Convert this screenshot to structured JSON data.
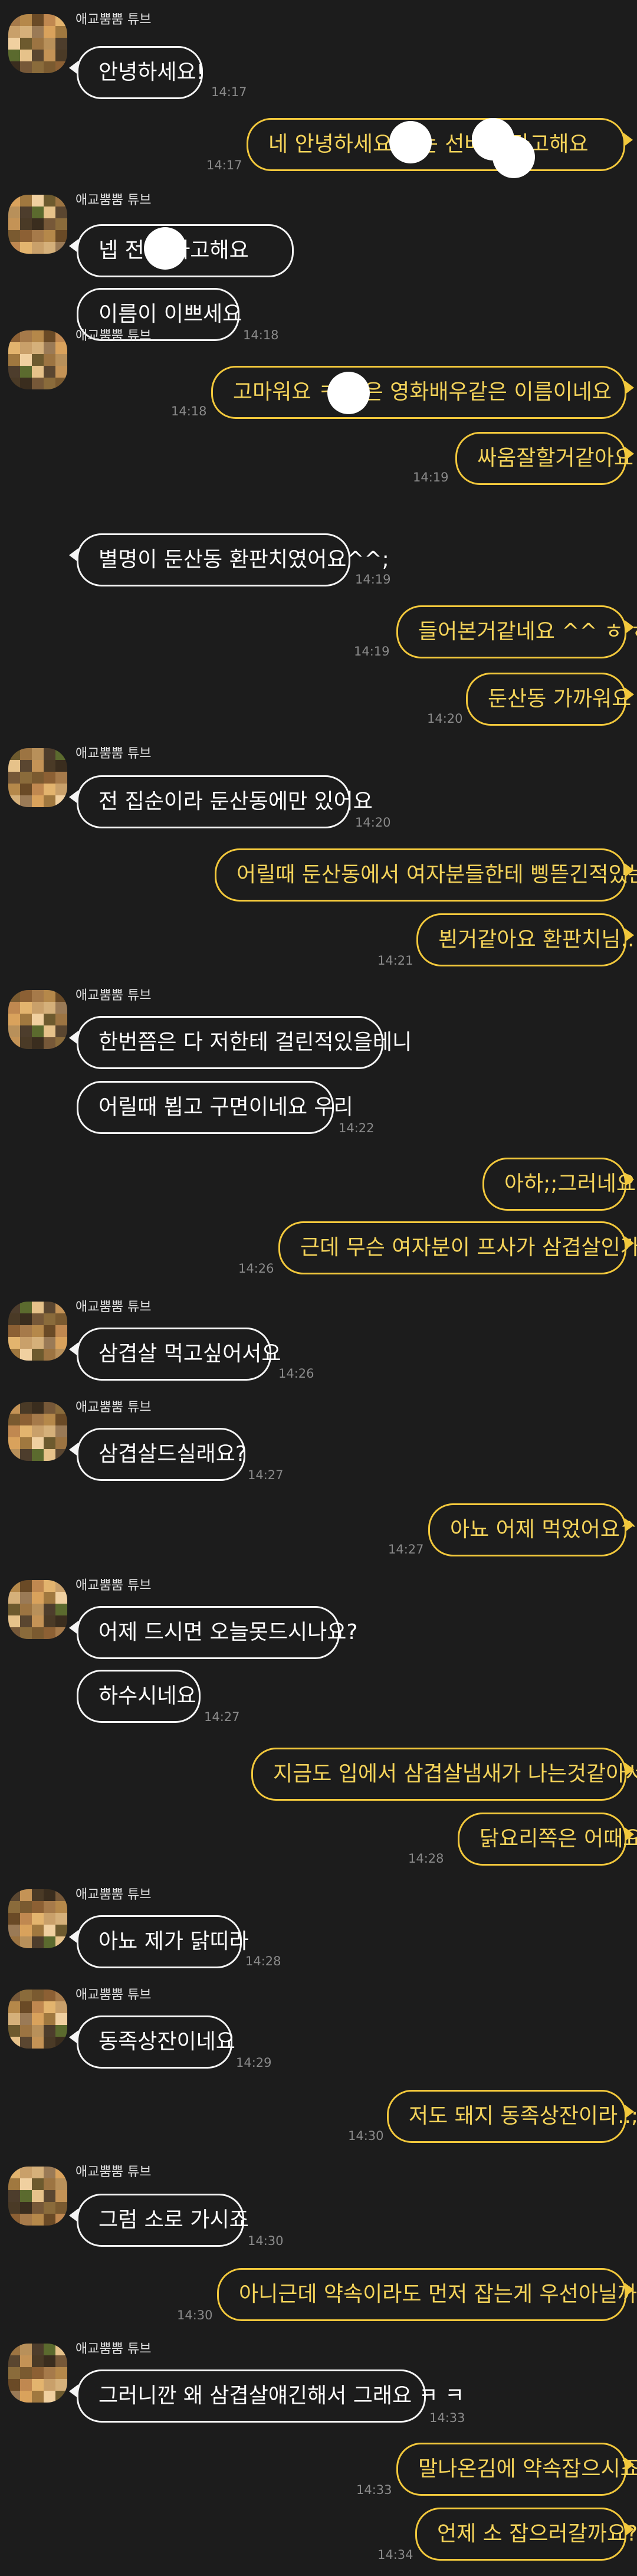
{
  "chat": {
    "sender_name": "애교뿜뿜 튜브",
    "colors": {
      "background": "#1c1c1c",
      "incoming_border": "#f5f5f5",
      "outgoing_border": "#f2c83c",
      "outgoing_text": "#f4d35a",
      "time": "#8a8a8a"
    },
    "messages": [
      {
        "side": "in",
        "text": "안녕하세요!",
        "time": "14:17"
      },
      {
        "side": "out",
        "text": "네 안녕하세요 저는 선배 이라고해요",
        "time": "14:17"
      },
      {
        "side": "in",
        "text": "넵 전 이라고해요",
        "time": ""
      },
      {
        "side": "in",
        "text": "이름이 이쁘세요",
        "time": "14:18"
      },
      {
        "side": "out",
        "text": "고마워요 ㅋ 님은 영화배우같은 이름이네요",
        "time": "14:18"
      },
      {
        "side": "out",
        "text": "싸움잘할거같아요",
        "time": "14:19"
      },
      {
        "side": "in",
        "text": "별명이 둔산동 환판치였어요^^;",
        "time": "14:19"
      },
      {
        "side": "out",
        "text": "들어본거같네요 ^^ ㅎ ㅎ..",
        "time": "14:19"
      },
      {
        "side": "out",
        "text": "둔산동 가까워요",
        "time": "14:20"
      },
      {
        "side": "in",
        "text": "전 집순이라 둔산동에만 있어요",
        "time": "14:20"
      },
      {
        "side": "out",
        "text": "어릴때 둔산동에서 여자분들한테 삥뜯긴적있는데",
        "time": ""
      },
      {
        "side": "out",
        "text": "뵌거같아요 환판치님..",
        "time": "14:21"
      },
      {
        "side": "in",
        "text": "한번쯤은 다 저한테 걸린적있을테니",
        "time": ""
      },
      {
        "side": "in",
        "text": "어릴때 뵙고 구면이네요 우리",
        "time": "14:22"
      },
      {
        "side": "out",
        "text": "아하;;그러네요",
        "time": ""
      },
      {
        "side": "out",
        "text": "근데 무슨 여자분이 프사가 삼겹살인가요",
        "time": "14:26"
      },
      {
        "side": "in",
        "text": "삼겹살 먹고싶어서요",
        "time": "14:26"
      },
      {
        "side": "in",
        "text": "삼겹살드실래요?",
        "time": "14:27"
      },
      {
        "side": "out",
        "text": "아뇨 어제 먹었어요^^",
        "time": "14:27"
      },
      {
        "side": "in",
        "text": "어제 드시면 오늘못드시나요?",
        "time": ""
      },
      {
        "side": "in",
        "text": "하수시네요",
        "time": "14:27"
      },
      {
        "side": "out",
        "text": "지금도 입에서 삼겹살냄새가 나는것같아서요",
        "time": ""
      },
      {
        "side": "out",
        "text": "닭요리쪽은 어때요",
        "time": "14:28"
      },
      {
        "side": "in",
        "text": "아뇨 제가 닭띠라",
        "time": "14:28"
      },
      {
        "side": "in",
        "text": "동족상잔이네요",
        "time": "14:29"
      },
      {
        "side": "out",
        "text": "저도 돼지 동족상잔이라..;",
        "time": "14:30"
      },
      {
        "side": "in",
        "text": "그럼 소로 가시죠",
        "time": "14:30"
      },
      {
        "side": "out",
        "text": "아니근데 약속이라도 먼저 잡는게 우선아닐까요?",
        "time": "14:30"
      },
      {
        "side": "in",
        "text": "그러니깐 왜 삼겹살얘긴해서 그래요 ㅋ ㅋ",
        "time": "14:33"
      },
      {
        "side": "out",
        "text": "말나온김에 약속잡으시죠",
        "time": "14:33"
      },
      {
        "side": "out",
        "text": "언제 소 잡으러갈까요?",
        "time": "14:34"
      }
    ]
  }
}
